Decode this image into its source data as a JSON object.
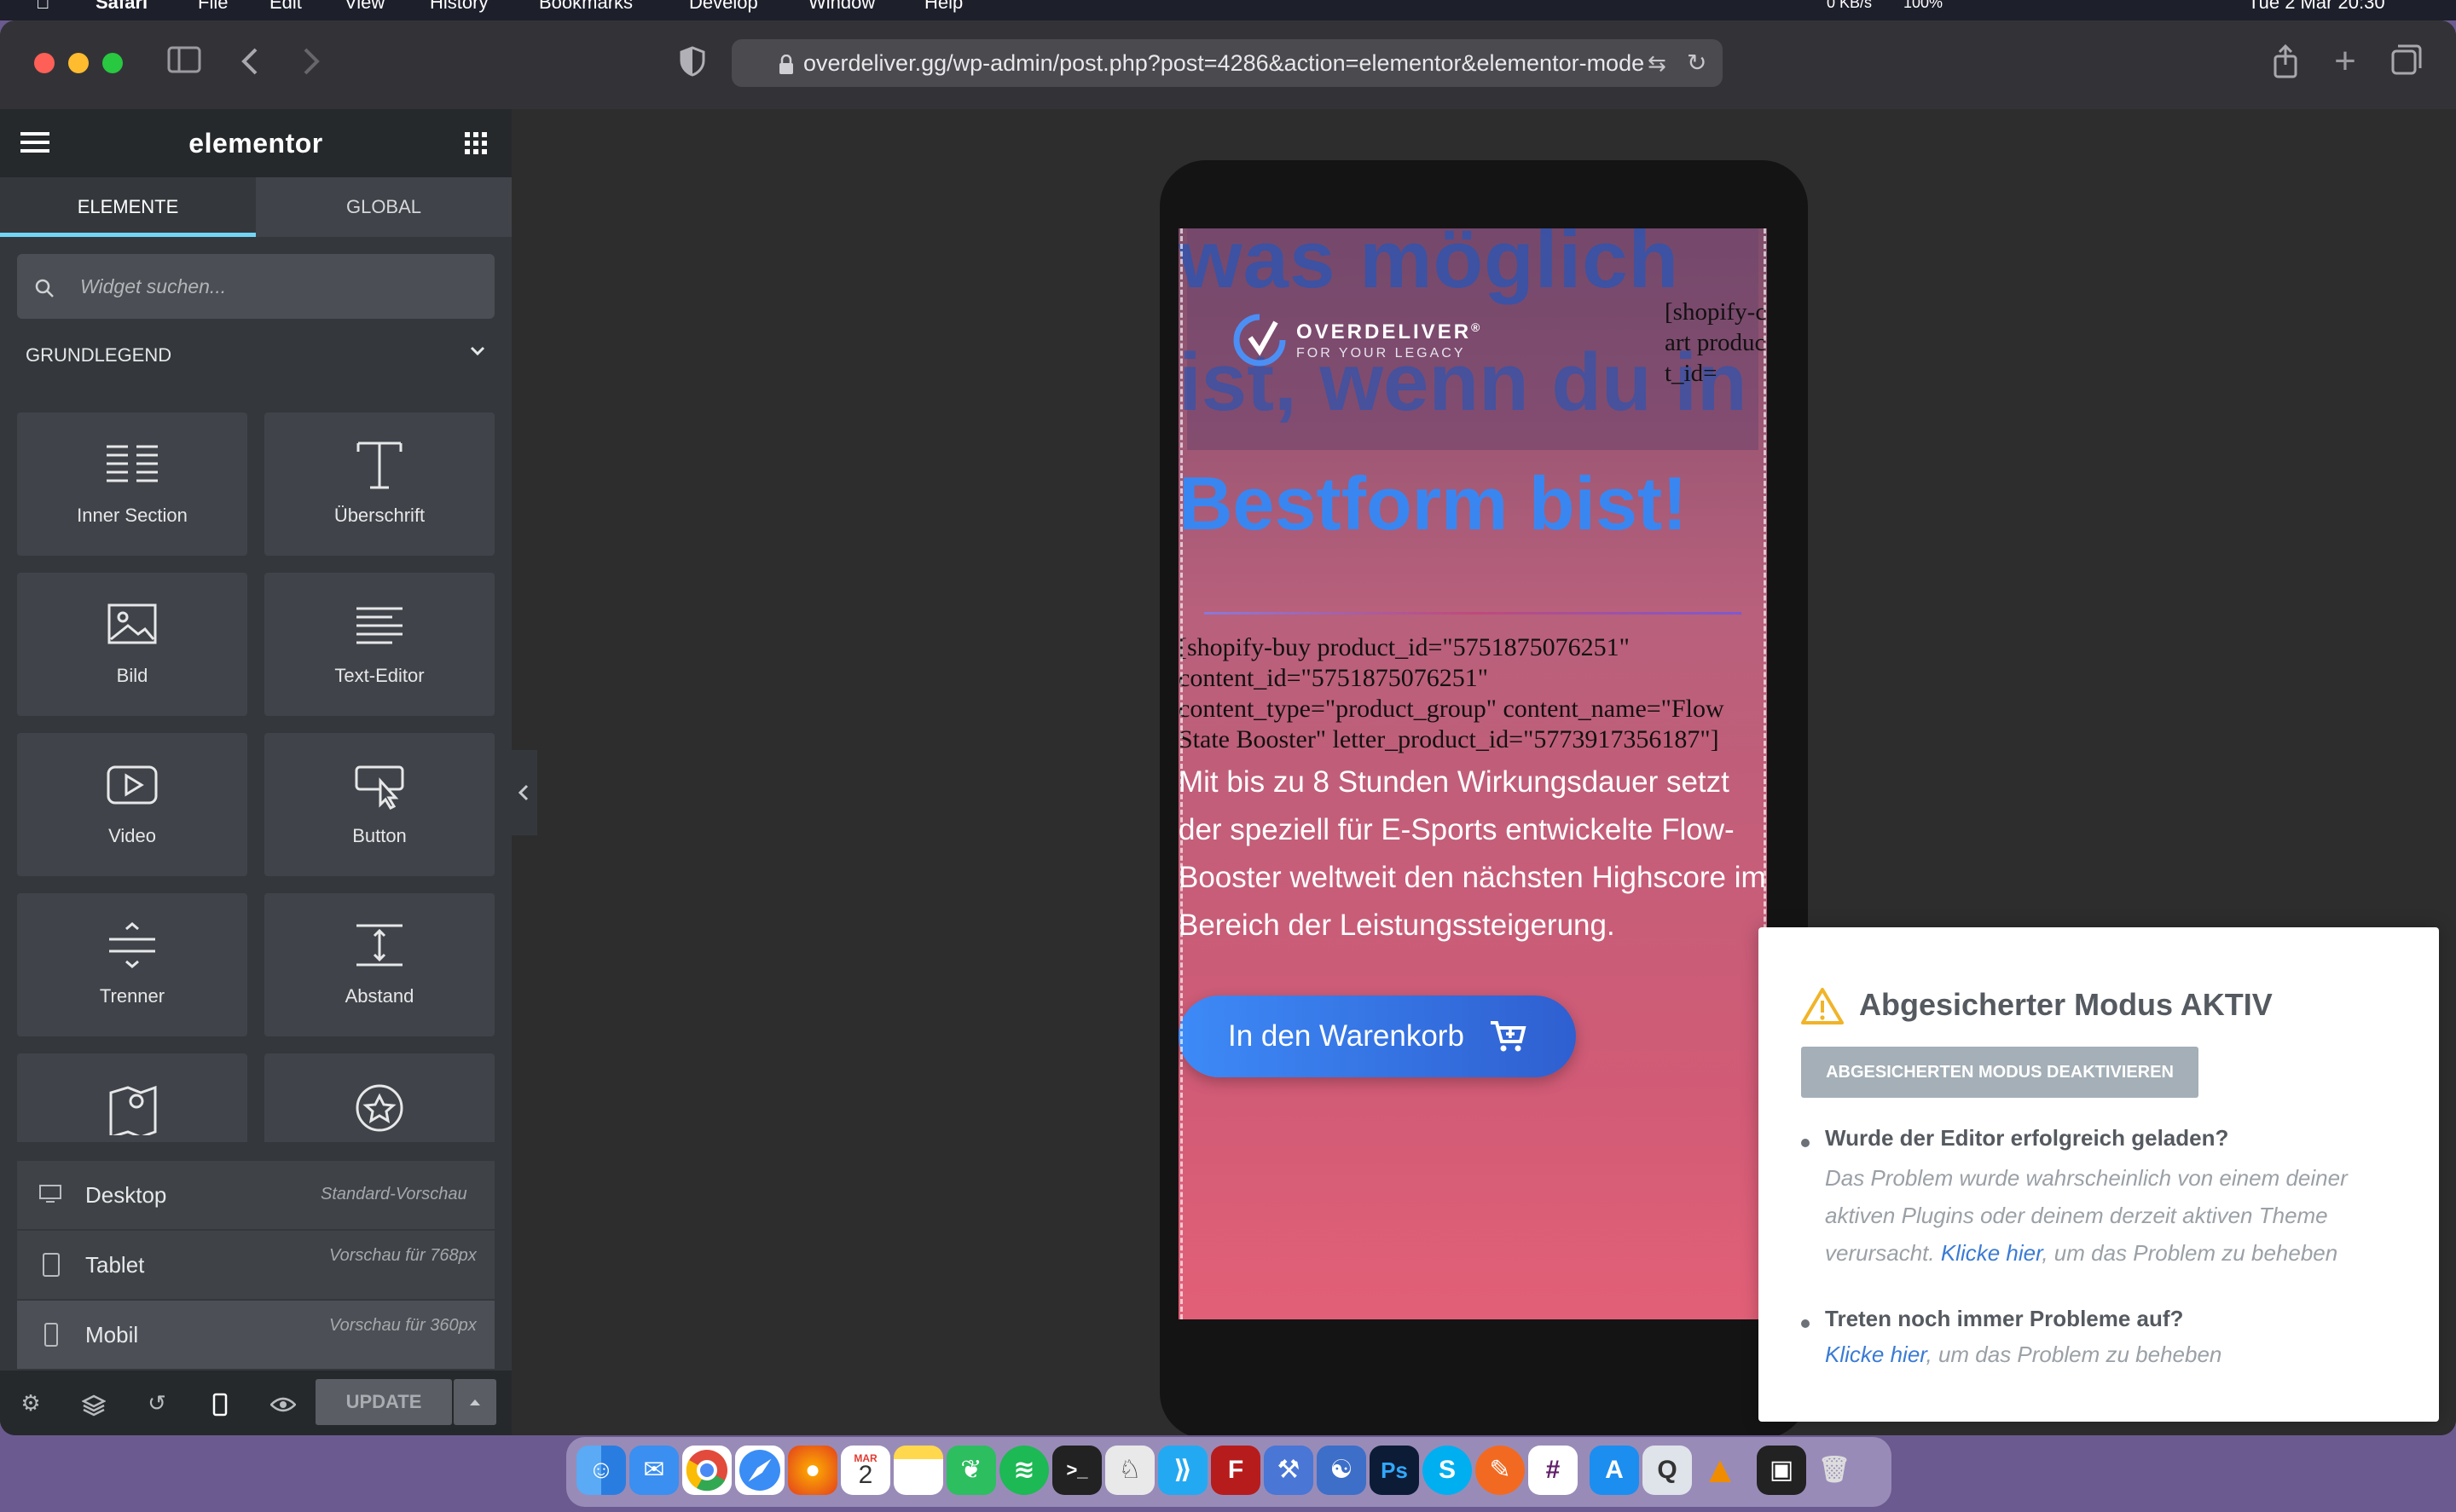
{
  "menubar": {
    "items": [
      "Safari",
      "File",
      "Edit",
      "View",
      "History",
      "Bookmarks",
      "Develop",
      "Window",
      "Help"
    ],
    "status": {
      "net": "0 KB/s",
      "cpu": "100%",
      "datetime": "Tue 2 Mar  20:30"
    }
  },
  "browser": {
    "url": "overdeliver.gg/wp-admin/post.php?post=4286&action=elementor&elementor-mode"
  },
  "panel": {
    "logo": "elementor",
    "tabs": [
      "ELEMENTE",
      "GLOBAL"
    ],
    "search_placeholder": "Widget suchen...",
    "section_title": "GRUNDLEGEND",
    "widgets": [
      {
        "label": "Inner Section",
        "icon": "inner-section-icon"
      },
      {
        "label": "Überschrift",
        "icon": "heading-icon"
      },
      {
        "label": "Bild",
        "icon": "image-icon"
      },
      {
        "label": "Text-Editor",
        "icon": "text-editor-icon"
      },
      {
        "label": "Video",
        "icon": "video-icon"
      },
      {
        "label": "Button",
        "icon": "button-icon"
      },
      {
        "label": "Trenner",
        "icon": "divider-icon"
      },
      {
        "label": "Abstand",
        "icon": "spacer-icon"
      }
    ],
    "devices": [
      {
        "name": "Desktop",
        "desc": "Standard-Vorschau"
      },
      {
        "name": "Tablet",
        "desc": "Vorschau für 768px"
      },
      {
        "name": "Mobil",
        "desc": "Vorschau für 360px"
      }
    ],
    "update_label": "UPDATE"
  },
  "preview": {
    "bg_heading_1": "was möglich",
    "bg_heading_2": "ist, wenn du in",
    "heading": "Bestform bist!",
    "logo_main": "OVERDELIVER",
    "logo_reg": "®",
    "logo_sub": "FOR YOUR LEGACY",
    "shortcode_cart": "[shopify-cart product_id=",
    "shortcode_buy": "[shopify-buy product_id=\"5751875076251\" content_id=\"5751875076251\" content_type=\"product_group\" content_name=\"Flow State Booster\" letter_product_id=\"5773917356187\"]",
    "paragraph": "Mit bis zu 8 Stunden Wirkungsdauer setzt der speziell für E-Sports entwickelte Flow-Booster weltweit den nächsten Highscore im Bereich der Leistungssteigerung.",
    "cart_button": "In den Warenkorb"
  },
  "safe_mode": {
    "title": "Abgesicherter Modus AKTIV",
    "button": "ABGESICHERTEN MODUS DEAKTIVIEREN",
    "q1": "Wurde der Editor erfolgreich geladen?",
    "a1_pre": "Das Problem wurde wahrscheinlich von einem deiner aktiven Plugins oder deinem derzeit aktiven Theme verursacht. ",
    "a1_link": "Klicke hier",
    "a1_post": ", um das Problem zu beheben",
    "q2": "Treten noch immer Probleme auf?",
    "a2_link": "Klicke hier",
    "a2_post": ", um das Problem zu beheben"
  },
  "dock": {
    "calendar_month": "MAR",
    "calendar_day": "2"
  },
  "colors": {
    "accent": "#3d8af7",
    "heading_blue": "#3a86f0",
    "panel_bg": "#34383c",
    "tab_active": "#71d7f7"
  }
}
